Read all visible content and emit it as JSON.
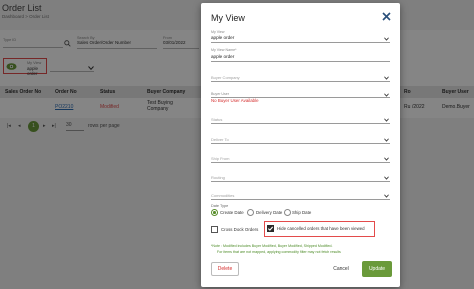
{
  "background": {
    "page_title": "Order List",
    "breadcrumb": "Dashboard  >  Order List",
    "filters": {
      "type_label": "Type ID",
      "search_by_label": "Search By",
      "search_by_value": "Sales Order/Order Number",
      "from_label": "From",
      "from_value": "03/01/2022",
      "my_view_label": "My View",
      "my_view_value": "apple order"
    },
    "table": {
      "headers": [
        "Sales Order No",
        "Order No",
        "Status",
        "Buyer Company",
        "Ro",
        "/2022",
        "Buyer User"
      ],
      "row": {
        "order_no": "PO2210",
        "status": "Modified",
        "buyer_company": "Test Buying Company",
        "ro": "Ru",
        "date": "/2022",
        "buyer_user": "Demo.Buyer"
      }
    },
    "pager": {
      "current_page": "1",
      "page_size": "30",
      "per_page_label": "rows per page"
    }
  },
  "modal": {
    "title": "My View",
    "fields": {
      "my_view_label": "My View",
      "my_view_value": "apple order",
      "view_name_label": "My View Name*",
      "view_name_value": "apple order",
      "buyer_company_placeholder": "Buyer Company",
      "buyer_user_label": "Buyer User",
      "buyer_user_error": "No Buyer User Available",
      "status_placeholder": "Status",
      "deliver_to_placeholder": "Deliver To",
      "ship_from_placeholder": "Ship From",
      "routing_placeholder": "Routing",
      "commodities_placeholder": "Commodities"
    },
    "date_type": {
      "label": "Date Type",
      "options": [
        "Create Date",
        "Delivery Date",
        "Ship Date"
      ],
      "selected": "Create Date"
    },
    "cross_dock": {
      "label": "Cross Dock Orders",
      "checked": false
    },
    "hide_cancelled": {
      "label": "Hide cancelled orders that have been viewed",
      "checked": true
    },
    "notes": [
      "*Note : Modified includes Buyer Modified, Buyer Modified, Shipped Modified.",
      "For items that are not mapped, applying commodity filter may not fetch results"
    ],
    "buttons": {
      "delete": "Delete",
      "cancel": "Cancel",
      "update": "Update"
    }
  },
  "colors": {
    "accent_green": "#6a9a3a",
    "error_red": "#d42a2a",
    "highlight_red": "#e34b4b",
    "link_blue": "#2d6db5"
  }
}
